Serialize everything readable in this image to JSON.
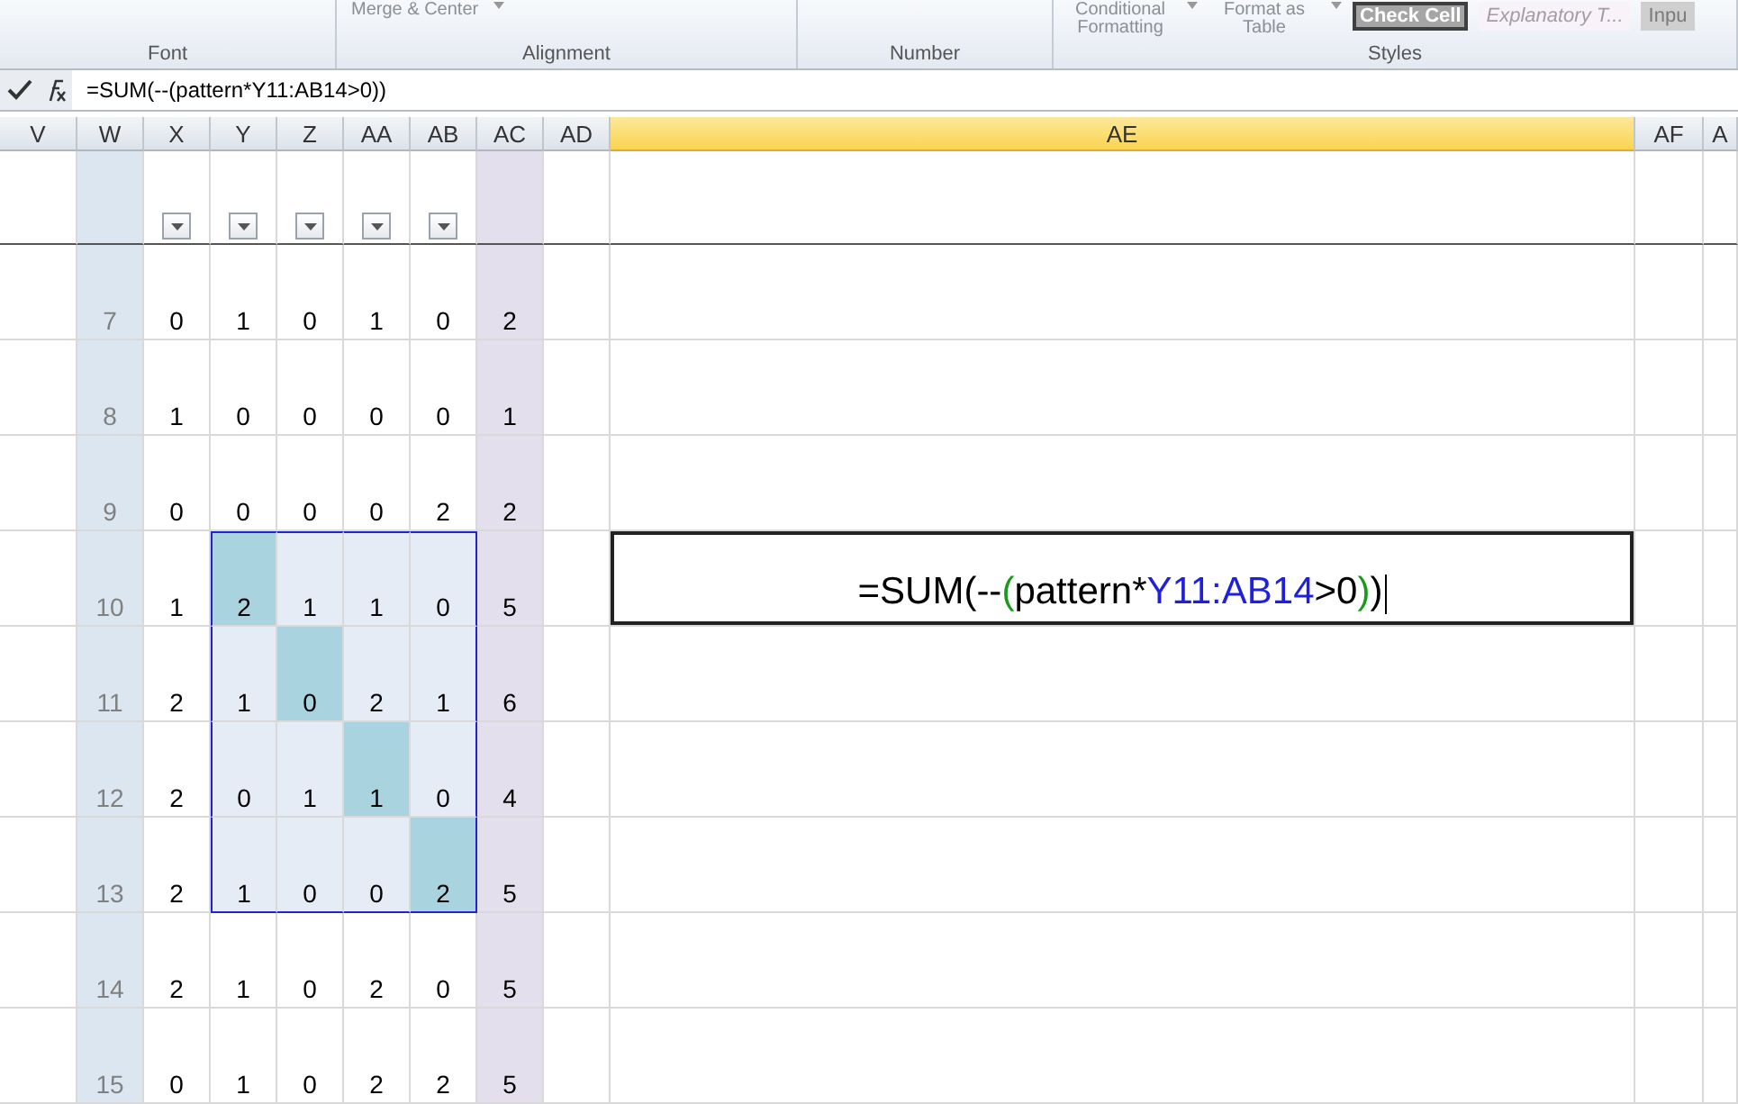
{
  "ribbon": {
    "groups": [
      {
        "label": "Font"
      },
      {
        "label": "Alignment",
        "buttons": [
          {
            "label": "Merge & Center"
          }
        ]
      },
      {
        "label": "Number"
      },
      {
        "label": "Styles",
        "buttons": [
          {
            "label": "Conditional Formatting"
          },
          {
            "label": "Format as Table"
          }
        ],
        "styles": [
          {
            "label": "Check Cell",
            "kind": "check"
          },
          {
            "label": "Explanatory T...",
            "kind": "explanatory"
          },
          {
            "label": "Inpu",
            "kind": "input"
          }
        ]
      }
    ]
  },
  "formula_bar": {
    "formula": "=SUM(--(pattern*Y11:AB14>0))"
  },
  "columns": [
    {
      "label": "V",
      "selected": false,
      "filter": false
    },
    {
      "label": "W",
      "selected": false,
      "filter": false
    },
    {
      "label": "X",
      "selected": false,
      "filter": true
    },
    {
      "label": "Y",
      "selected": false,
      "filter": true
    },
    {
      "label": "Z",
      "selected": false,
      "filter": true
    },
    {
      "label": "AA",
      "selected": false,
      "filter": true
    },
    {
      "label": "AB",
      "selected": false,
      "filter": true
    },
    {
      "label": "AC",
      "selected": false,
      "filter": false
    },
    {
      "label": "AD",
      "selected": false,
      "filter": false
    },
    {
      "label": "AE",
      "selected": true,
      "filter": false
    },
    {
      "label": "AF",
      "selected": false,
      "filter": false
    },
    {
      "label": "A",
      "selected": false,
      "filter": false
    }
  ],
  "rows": [
    {
      "number": "7",
      "total": "2",
      "values": [
        {
          "text": "0",
          "highlighted": false,
          "selected": false
        },
        {
          "text": "1",
          "highlighted": false,
          "selected": false
        },
        {
          "text": "0",
          "highlighted": false,
          "selected": false
        },
        {
          "text": "1",
          "highlighted": false,
          "selected": false
        },
        {
          "text": "0",
          "highlighted": false,
          "selected": false
        }
      ]
    },
    {
      "number": "8",
      "total": "1",
      "values": [
        {
          "text": "1",
          "highlighted": false,
          "selected": false
        },
        {
          "text": "0",
          "highlighted": false,
          "selected": false
        },
        {
          "text": "0",
          "highlighted": false,
          "selected": false
        },
        {
          "text": "0",
          "highlighted": false,
          "selected": false
        },
        {
          "text": "0",
          "highlighted": false,
          "selected": false
        }
      ]
    },
    {
      "number": "9",
      "total": "2",
      "values": [
        {
          "text": "0",
          "highlighted": false,
          "selected": false
        },
        {
          "text": "0",
          "highlighted": false,
          "selected": false
        },
        {
          "text": "0",
          "highlighted": false,
          "selected": false
        },
        {
          "text": "0",
          "highlighted": false,
          "selected": false
        },
        {
          "text": "2",
          "highlighted": false,
          "selected": false
        }
      ]
    },
    {
      "number": "10",
      "total": "5",
      "values": [
        {
          "text": "1",
          "highlighted": false,
          "selected": false
        },
        {
          "text": "2",
          "highlighted": true,
          "selected": true
        },
        {
          "text": "1",
          "highlighted": false,
          "selected": true
        },
        {
          "text": "1",
          "highlighted": false,
          "selected": true
        },
        {
          "text": "0",
          "highlighted": false,
          "selected": true
        }
      ],
      "editor": [
        {
          "text": "=SUM(--",
          "color": "#000000"
        },
        {
          "text": "(",
          "color": "#1a9a1a"
        },
        {
          "text": "pattern*",
          "color": "#000000"
        },
        {
          "text": "Y11:AB14",
          "color": "#1f1fe0"
        },
        {
          "text": ">0",
          "color": "#000000"
        },
        {
          "text": ")",
          "color": "#1a9a1a"
        },
        {
          "text": ")",
          "color": "#000000"
        }
      ]
    },
    {
      "number": "11",
      "total": "6",
      "values": [
        {
          "text": "2",
          "highlighted": false,
          "selected": false
        },
        {
          "text": "1",
          "highlighted": false,
          "selected": true
        },
        {
          "text": "0",
          "highlighted": true,
          "selected": true
        },
        {
          "text": "2",
          "highlighted": false,
          "selected": true
        },
        {
          "text": "1",
          "highlighted": false,
          "selected": true
        }
      ]
    },
    {
      "number": "12",
      "total": "4",
      "values": [
        {
          "text": "2",
          "highlighted": false,
          "selected": false
        },
        {
          "text": "0",
          "highlighted": false,
          "selected": true
        },
        {
          "text": "1",
          "highlighted": false,
          "selected": true
        },
        {
          "text": "1",
          "highlighted": true,
          "selected": true
        },
        {
          "text": "0",
          "highlighted": false,
          "selected": true
        }
      ]
    },
    {
      "number": "13",
      "total": "5",
      "values": [
        {
          "text": "2",
          "highlighted": false,
          "selected": false
        },
        {
          "text": "1",
          "highlighted": false,
          "selected": true
        },
        {
          "text": "0",
          "highlighted": false,
          "selected": true
        },
        {
          "text": "0",
          "highlighted": false,
          "selected": true
        },
        {
          "text": "2",
          "highlighted": true,
          "selected": true
        }
      ]
    },
    {
      "number": "14",
      "total": "5",
      "values": [
        {
          "text": "2",
          "highlighted": false,
          "selected": false
        },
        {
          "text": "1",
          "highlighted": false,
          "selected": false
        },
        {
          "text": "0",
          "highlighted": false,
          "selected": false
        },
        {
          "text": "2",
          "highlighted": false,
          "selected": false
        },
        {
          "text": "0",
          "highlighted": false,
          "selected": false
        }
      ]
    },
    {
      "number": "15",
      "total": "5",
      "values": [
        {
          "text": "0",
          "highlighted": false,
          "selected": false
        },
        {
          "text": "1",
          "highlighted": false,
          "selected": false
        },
        {
          "text": "0",
          "highlighted": false,
          "selected": false
        },
        {
          "text": "2",
          "highlighted": false,
          "selected": false
        },
        {
          "text": "2",
          "highlighted": false,
          "selected": false
        }
      ]
    }
  ]
}
